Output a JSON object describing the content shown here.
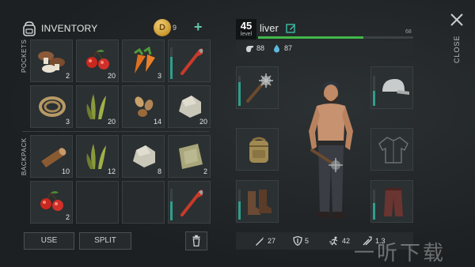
{
  "inventory": {
    "title": "INVENTORY",
    "coins": "9",
    "coin_symbol": "D",
    "add_label": "+",
    "pockets_label": "POCKETS",
    "backpack_label": "BACKPACK",
    "pockets": [
      {
        "icon": "mushrooms-icon",
        "count": "2"
      },
      {
        "icon": "berries-icon",
        "count": "20"
      },
      {
        "icon": "carrots-icon",
        "count": "3"
      },
      {
        "icon": "crowbar-icon",
        "count": "",
        "durability": 0.7
      },
      {
        "icon": "rope-icon",
        "count": "3"
      },
      {
        "icon": "plant-fiber-icon",
        "count": "20"
      },
      {
        "icon": "seeds-icon",
        "count": "14"
      },
      {
        "icon": "stone-icon",
        "count": "20"
      }
    ],
    "backpack": [
      {
        "icon": "log-icon",
        "count": "10"
      },
      {
        "icon": "plant-fiber-icon",
        "count": "12"
      },
      {
        "icon": "stone-icon",
        "count": "8"
      },
      {
        "icon": "cloth-icon",
        "count": "2"
      },
      {
        "icon": "berries-icon",
        "count": "2"
      },
      {
        "icon": "",
        "count": ""
      },
      {
        "icon": "",
        "count": ""
      },
      {
        "icon": "crowbar-icon",
        "count": "",
        "durability": 0.6
      }
    ],
    "use_label": "USE",
    "split_label": "SPLIT"
  },
  "player": {
    "level": "45",
    "level_label": "level",
    "name": "liver",
    "xp_value": "68",
    "xp_fraction": 0.68,
    "hunger": "88",
    "thirst": "87"
  },
  "equipment": {
    "weapon": {
      "icon": "spiked-club-icon",
      "durability": 0.8
    },
    "backpack": {
      "icon": "backpack-icon"
    },
    "boots": {
      "icon": "boots-icon",
      "durability": 0.6
    },
    "head": {
      "icon": "cap-icon",
      "durability": 0.5
    },
    "torso": {
      "icon": "jacket-icon"
    },
    "legs": {
      "icon": "pants-icon",
      "durability": 0.55
    }
  },
  "combat_stats": {
    "damage": "27",
    "defense": "5",
    "speed": "42",
    "attack_speed": "1.3"
  },
  "close_label": "CLOSE",
  "watermark": "一听下载",
  "colors": {
    "accent": "#2f9f8c",
    "xp": "#43b84a",
    "edit": "#3cc0a6"
  }
}
